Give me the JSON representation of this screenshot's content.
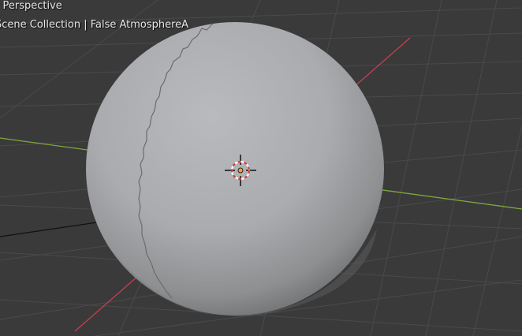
{
  "viewport": {
    "view_name": "r Perspective",
    "collection_path": "Scene Collection | False AtmosphereA"
  },
  "colors": {
    "background": "#3a3a3a",
    "grid_line": "#494949",
    "x_axis": "#c4404f",
    "y_axis": "#7fa83d",
    "sphere_light": "#b9bbbe",
    "sphere_dark": "#6e7072",
    "cursor_red": "#d23a3a"
  },
  "icons": {
    "object_origin": "origin-dot-icon",
    "3d_cursor": "3d-cursor-icon"
  }
}
